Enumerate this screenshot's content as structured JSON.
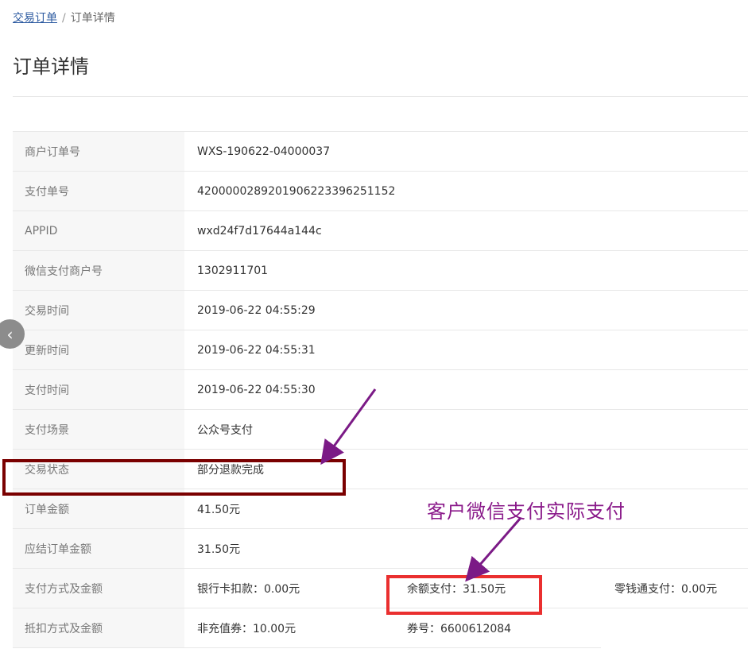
{
  "breadcrumb": {
    "link": "交易订单",
    "separator": "/",
    "current": "订单详情"
  },
  "page_title": "订单详情",
  "rows": [
    {
      "label": "商户订单号",
      "value": "WXS-190622-04000037"
    },
    {
      "label": "支付单号",
      "value": "4200000289201906223396251152"
    },
    {
      "label": "APPID",
      "value": "wxd24f7d17644a144c"
    },
    {
      "label": "微信支付商户号",
      "value": "1302911701"
    },
    {
      "label": "交易时间",
      "value": "2019-06-22 04:55:29"
    },
    {
      "label": "更新时间",
      "value": "2019-06-22 04:55:31"
    },
    {
      "label": "支付时间",
      "value": "2019-06-22 04:55:30"
    },
    {
      "label": "支付场景",
      "value": "公众号支付"
    },
    {
      "label": "交易状态",
      "value": "部分退款完成"
    },
    {
      "label": "订单金额",
      "value": "41.50元"
    },
    {
      "label": "应结订单金额",
      "value": "31.50元"
    }
  ],
  "payment_row": {
    "label": "支付方式及金额",
    "bank": "银行卡扣款：0.00元",
    "balance": "余额支付：31.50元",
    "change": "零钱通支付：0.00元"
  },
  "deduction_row": {
    "label": "抵扣方式及金额",
    "voucher": "非充值券：10.00元",
    "coupon_no": "券号：6600612084"
  },
  "annotation": {
    "text": "客户微信支付实际支付",
    "arrow_color": "#7b1a86",
    "dark_box_color": "#7a0000",
    "red_box_color": "#ea2f2f"
  },
  "icons": {
    "back": "chevron-left-icon"
  }
}
